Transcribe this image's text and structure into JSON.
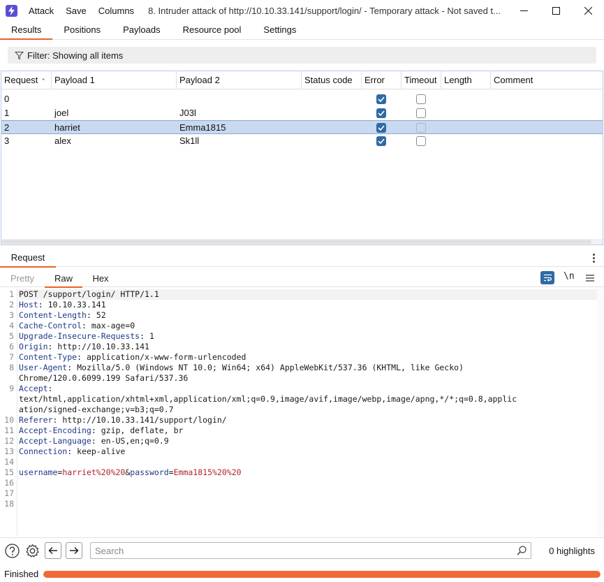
{
  "window": {
    "menu": [
      "Attack",
      "Save",
      "Columns"
    ],
    "title": "8. Intruder attack of http://10.10.33.141/support/login/ - Temporary attack - Not saved t..."
  },
  "tabs": [
    "Results",
    "Positions",
    "Payloads",
    "Resource pool",
    "Settings"
  ],
  "filter": {
    "label": "Filter: Showing all items"
  },
  "table": {
    "columns": [
      "Request",
      "Payload 1",
      "Payload 2",
      "Status code",
      "Error",
      "Timeout",
      "Length",
      "Comment"
    ],
    "rows": [
      {
        "request": "0",
        "payload1": "",
        "payload2": "",
        "status": "",
        "error": true,
        "timeout": false,
        "length": "",
        "comment": ""
      },
      {
        "request": "1",
        "payload1": "joel",
        "payload2": "J03l",
        "status": "",
        "error": true,
        "timeout": false,
        "length": "",
        "comment": ""
      },
      {
        "request": "2",
        "payload1": "harriet",
        "payload2": "Emma1815",
        "status": "",
        "error": true,
        "timeout": false,
        "length": "",
        "comment": ""
      },
      {
        "request": "3",
        "payload1": "alex",
        "payload2": "Sk1ll",
        "status": "",
        "error": true,
        "timeout": false,
        "length": "",
        "comment": ""
      }
    ],
    "selected_row": 2
  },
  "request_panel": {
    "tab": "Request",
    "subtabs": [
      "Pretty",
      "Raw",
      "Hex"
    ],
    "active_subtab": "Raw",
    "newline_toggle": "\\n"
  },
  "editor": {
    "lines": [
      {
        "n": "1",
        "key": "",
        "value": "POST /support/login/ HTTP/1.1"
      },
      {
        "n": "2",
        "key": "Host",
        "value": " 10.10.33.141"
      },
      {
        "n": "3",
        "key": "Content-Length",
        "value": " 52"
      },
      {
        "n": "4",
        "key": "Cache-Control",
        "value": " max-age=0"
      },
      {
        "n": "5",
        "key": "Upgrade-Insecure-Requests",
        "value": " 1"
      },
      {
        "n": "6",
        "key": "Origin",
        "value": " http://10.10.33.141"
      },
      {
        "n": "7",
        "key": "Content-Type",
        "value": " application/x-www-form-urlencoded"
      },
      {
        "n": "8",
        "key": "User-Agent",
        "value": " Mozilla/5.0 (Windows NT 10.0; Win64; x64) AppleWebKit/537.36 (KHTML, like Gecko)"
      },
      {
        "n": "",
        "key": "",
        "value": "Chrome/120.0.6099.199 Safari/537.36"
      },
      {
        "n": "9",
        "key": "Accept",
        "value": ""
      },
      {
        "n": "",
        "key": "",
        "value": "text/html,application/xhtml+xml,application/xml;q=0.9,image/avif,image/webp,image/apng,*/*;q=0.8,applic"
      },
      {
        "n": "",
        "key": "",
        "value": "ation/signed-exchange;v=b3;q=0.7"
      },
      {
        "n": "10",
        "key": "Referer",
        "value": " http://10.10.33.141/support/login/"
      },
      {
        "n": "11",
        "key": "Accept-Encoding",
        "value": " gzip, deflate, br"
      },
      {
        "n": "12",
        "key": "Accept-Language",
        "value": " en-US,en;q=0.9"
      },
      {
        "n": "13",
        "key": "Connection",
        "value": " keep-alive"
      },
      {
        "n": "14",
        "key": "",
        "value": ""
      },
      {
        "n": "15",
        "key": "",
        "value": ""
      },
      {
        "n": "16",
        "key": "",
        "value": ""
      },
      {
        "n": "17",
        "key": "",
        "value": ""
      },
      {
        "n": "18",
        "key": "",
        "value": ""
      }
    ],
    "body_line": {
      "k1": "username",
      "eq1": "=",
      "v1": "harriet%20%20",
      "amp": "&",
      "k2": "password",
      "eq2": "=",
      "v2": "Emma1815%20%20"
    }
  },
  "bottom": {
    "search_placeholder": "Search",
    "highlights": "0 highlights"
  },
  "status": {
    "text": "Finished",
    "progress": 1.0
  },
  "colors": {
    "accent": "#e8632b",
    "checkbox_on": "#2f6aa6",
    "selected_row": "#c8d9f0",
    "progress": "#ef6a36"
  }
}
